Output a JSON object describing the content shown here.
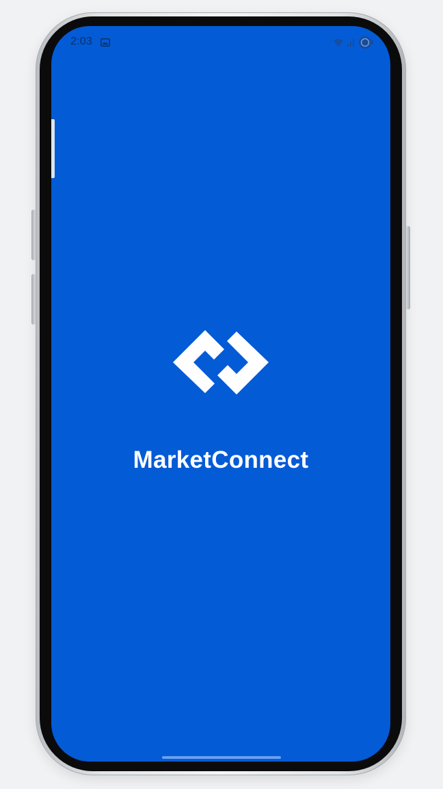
{
  "status_bar": {
    "time": "2:03",
    "notification_icon": "image-notification-icon",
    "icons": [
      "wifi-icon",
      "signal-icon",
      "battery-icon"
    ]
  },
  "splash": {
    "logo_icon": "marketconnect-logo-icon",
    "app_name": "MarketConnect"
  },
  "colors": {
    "brand": "#035bd6",
    "text": "#ffffff",
    "status_text": "#0c2f66"
  }
}
